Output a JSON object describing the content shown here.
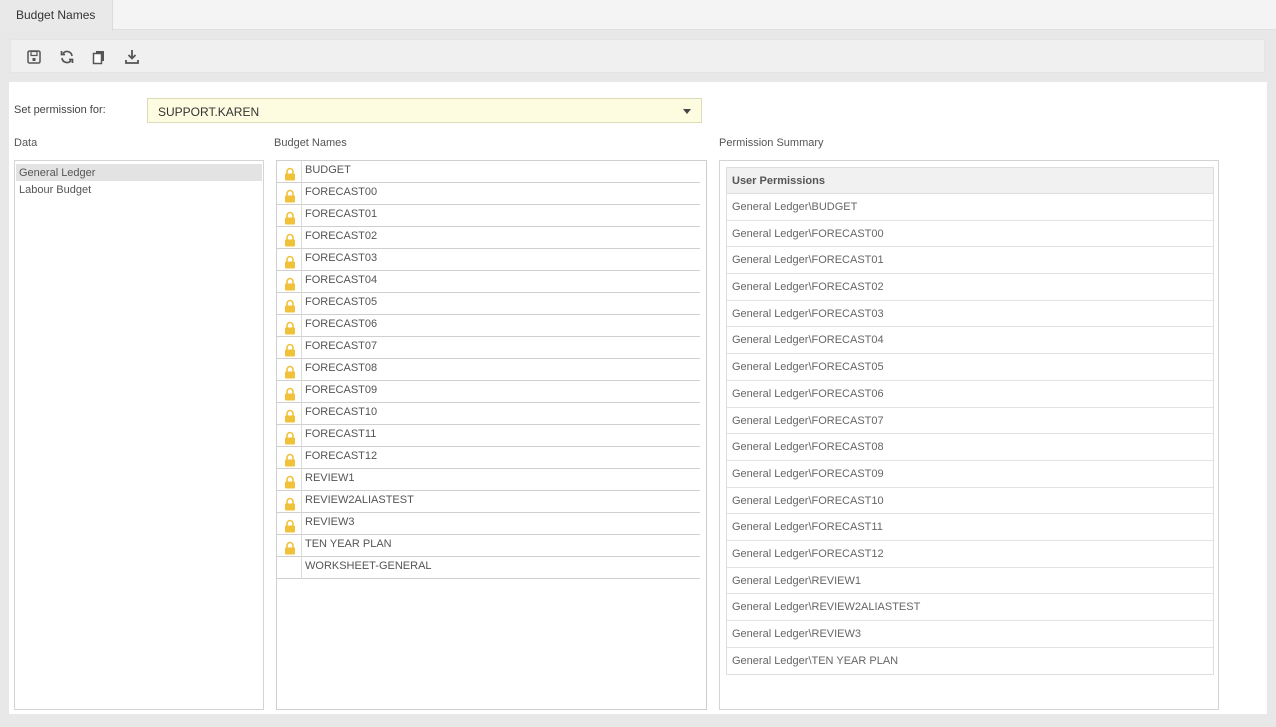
{
  "tabs": [
    {
      "label": "Budget Names"
    }
  ],
  "toolbar": {
    "icons": [
      "save-icon",
      "refresh-icon",
      "copy-icon",
      "download-icon"
    ]
  },
  "permission": {
    "label": "Set permission for:",
    "value": "SUPPORT.KAREN"
  },
  "data_section": {
    "label": "Data",
    "items": [
      {
        "label": "General Ledger",
        "selected": true
      },
      {
        "label": "Labour Budget",
        "selected": false
      }
    ]
  },
  "budget_section": {
    "label": "Budget Names",
    "rows": [
      {
        "name": "BUDGET",
        "locked": true
      },
      {
        "name": "FORECAST00",
        "locked": true
      },
      {
        "name": "FORECAST01",
        "locked": true
      },
      {
        "name": "FORECAST02",
        "locked": true
      },
      {
        "name": "FORECAST03",
        "locked": true
      },
      {
        "name": "FORECAST04",
        "locked": true
      },
      {
        "name": "FORECAST05",
        "locked": true
      },
      {
        "name": "FORECAST06",
        "locked": true
      },
      {
        "name": "FORECAST07",
        "locked": true
      },
      {
        "name": "FORECAST08",
        "locked": true
      },
      {
        "name": "FORECAST09",
        "locked": true
      },
      {
        "name": "FORECAST10",
        "locked": true
      },
      {
        "name": "FORECAST11",
        "locked": true
      },
      {
        "name": "FORECAST12",
        "locked": true
      },
      {
        "name": "REVIEW1",
        "locked": true
      },
      {
        "name": "REVIEW2ALIASTEST",
        "locked": true
      },
      {
        "name": "REVIEW3",
        "locked": true
      },
      {
        "name": "TEN YEAR PLAN",
        "locked": true
      },
      {
        "name": "WORKSHEET-GENERAL",
        "locked": false
      }
    ]
  },
  "summary_section": {
    "label": "Permission Summary",
    "header": "User Permissions",
    "rows": [
      "General Ledger\\BUDGET",
      "General Ledger\\FORECAST00",
      "General Ledger\\FORECAST01",
      "General Ledger\\FORECAST02",
      "General Ledger\\FORECAST03",
      "General Ledger\\FORECAST04",
      "General Ledger\\FORECAST05",
      "General Ledger\\FORECAST06",
      "General Ledger\\FORECAST07",
      "General Ledger\\FORECAST08",
      "General Ledger\\FORECAST09",
      "General Ledger\\FORECAST10",
      "General Ledger\\FORECAST11",
      "General Ledger\\FORECAST12",
      "General Ledger\\REVIEW1",
      "General Ledger\\REVIEW2ALIASTEST",
      "General Ledger\\REVIEW3",
      "General Ledger\\TEN YEAR PLAN"
    ]
  },
  "colors": {
    "lock": "#f0c23a",
    "select_bg": "#fdfce0",
    "selected_item_bg": "#e3e3e3"
  }
}
